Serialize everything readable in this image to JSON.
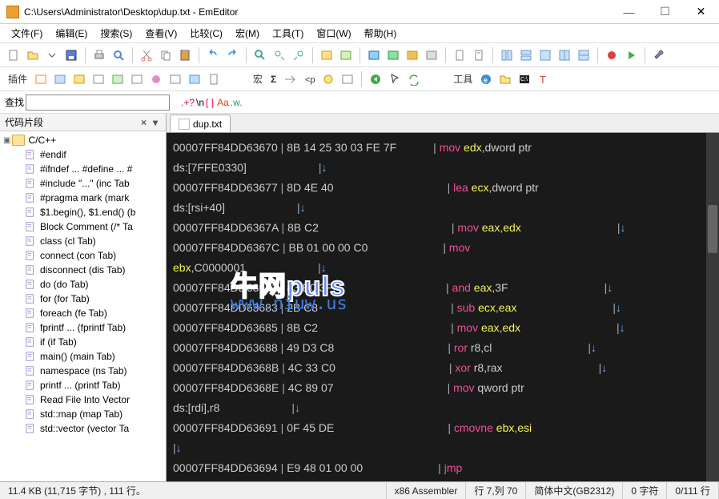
{
  "window": {
    "title": "C:\\Users\\Administrator\\Desktop\\dup.txt - EmEditor",
    "min": "—",
    "max": "☐",
    "close": "✕"
  },
  "menu": {
    "file": "文件(F)",
    "edit": "编辑(E)",
    "search": "搜索(S)",
    "view": "查看(V)",
    "compare": "比较(C)",
    "macro": "宏(M)",
    "tools": "工具(T)",
    "window": "窗口(W)",
    "help": "帮助(H)"
  },
  "toolbar2": {
    "plugin_label": "插件",
    "macro_label": "宏",
    "sigma": "Σ",
    "tools_label": "工具"
  },
  "search": {
    "label": "查找",
    "dotq": ".+?",
    "bsn": "\\n",
    "brk": "[ ]",
    "aa": "Aa",
    "w": ".w."
  },
  "sidebar": {
    "title": "代码片段",
    "root": "C/C++",
    "items": [
      "#endif",
      "#ifndef ... #define ... #",
      "#include \"...\"  (inc Tab",
      "#pragma mark  (mark",
      "$1.begin(), $1.end()  (b",
      "Block Comment  (/* Ta",
      "class  (cl Tab)",
      "connect  (con Tab)",
      "disconnect  (dis Tab)",
      "do  (do Tab)",
      "for  (for Tab)",
      "foreach  (fe Tab)",
      "fprintf ...  (fprintf Tab)",
      "if  (if Tab)",
      "main()  (main Tab)",
      "namespace  (ns Tab)",
      "printf ...  (printf Tab)",
      "Read File Into Vector",
      "std::map  (map Tab)",
      "std::vector  (vector Ta"
    ]
  },
  "tab": {
    "name": "dup.txt"
  },
  "code": {
    "lines": [
      {
        "addr": "00007FF84DD63670",
        "bytes": "8B 14 25 30 03 FE 7F",
        "mn": "mov",
        "args_html": "<span class='reg'>edx</span>,dword ptr"
      },
      {
        "cont": "ds:[7FFE0330]",
        "arrow": true
      },
      {
        "addr": "00007FF84DD63677",
        "bytes": "8D 4E 40",
        "mn": "lea",
        "args_html": "<span class='reg'>ecx</span>,dword ptr"
      },
      {
        "cont": "ds:[rsi+40]",
        "arrow": true
      },
      {
        "addr": "00007FF84DD6367A",
        "bytes": "8B C2",
        "mn": "mov",
        "args_html": "<span class='reg'>eax</span>,<span class='reg'>edx</span>",
        "tail_arrow": true
      },
      {
        "addr": "00007FF84DD6367C",
        "bytes": "BB 01 00 00 C0",
        "mn": "mov",
        "args_html": ""
      },
      {
        "cont_html": "<span class='reg'>ebx</span>,C0000001",
        "arrow": true
      },
      {
        "addr": "00007FF84DD63681",
        "bytes": "83 E0 3F",
        "mn": "and",
        "args_html": "<span class='reg'>eax</span>,3F",
        "tail_arrow": true
      },
      {
        "addr": "00007FF84DD63683",
        "bytes": "2B C8",
        "mn": "sub",
        "args_html": "<span class='reg'>ecx</span>,<span class='reg'>eax</span>",
        "tail_arrow": true
      },
      {
        "addr": "00007FF84DD63685",
        "bytes": "8B C2",
        "mn": "mov",
        "args_html": "<span class='reg'>eax</span>,<span class='reg'>edx</span>",
        "tail_arrow": true
      },
      {
        "addr": "00007FF84DD63688",
        "bytes": "49 D3 C8",
        "mn": "ror",
        "args_html": "r8,cl",
        "tail_arrow": true
      },
      {
        "addr": "00007FF84DD6368B",
        "bytes": "4C 33 C0",
        "mn": "xor",
        "args_html": "r8,rax",
        "tail_arrow": true
      },
      {
        "addr": "00007FF84DD6368E",
        "bytes": "4C 89 07",
        "mn": "mov",
        "args_html": "qword ptr"
      },
      {
        "cont": "ds:[rdi],r8",
        "arrow": true
      },
      {
        "addr": "00007FF84DD63691",
        "bytes": "0F 45 DE",
        "mn": "cmovne",
        "args_html": "<span class='reg'>ebx</span>,<span class='reg'>esi</span>"
      },
      {
        "arrow_only": true
      },
      {
        "addr": "00007FF84DD63694",
        "bytes": "E9 48 01 00 00",
        "mn": "jmp",
        "args_html": ""
      }
    ]
  },
  "watermark": {
    "line1a": "牛网",
    "line1b": "puls",
    "line2": "www.niuw.us"
  },
  "status": {
    "size": "11.4 KB (11,715 字节) , 111 行。",
    "lang": "x86 Assembler",
    "pos": "行 7,列 70",
    "enc": "简体中文(GB2312)",
    "sel": "0 字符",
    "lines": "0/111 行"
  }
}
